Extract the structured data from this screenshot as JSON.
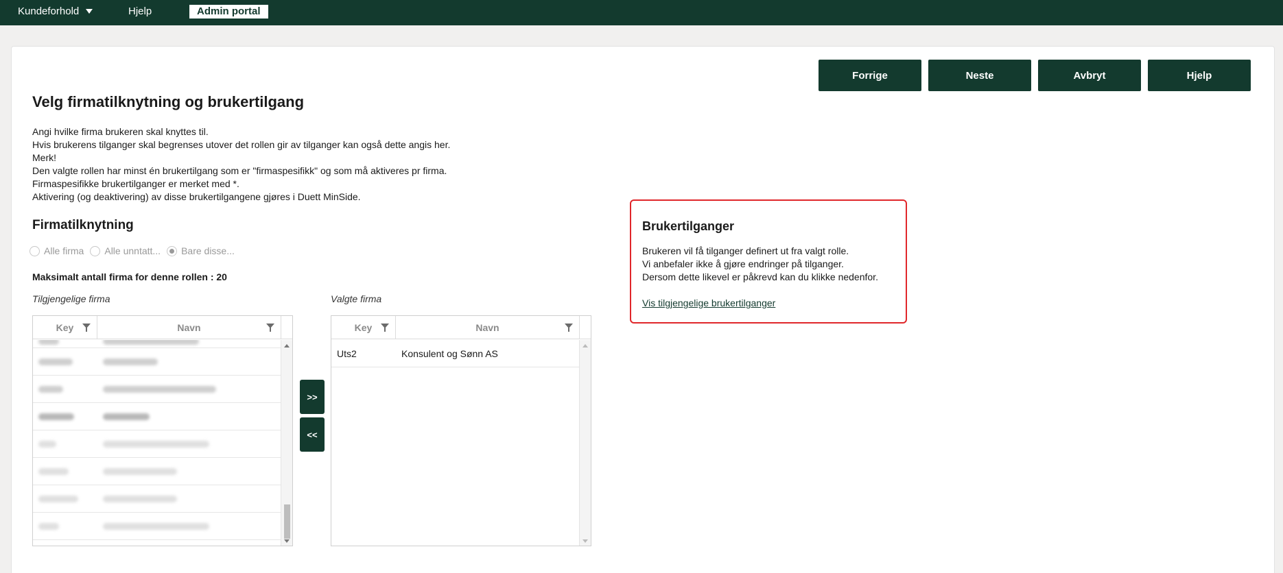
{
  "topnav": {
    "kundeforhold": "Kundeforhold",
    "hjelp": "Hjelp",
    "admin_portal": "Admin portal"
  },
  "actions": {
    "forrige": "Forrige",
    "neste": "Neste",
    "avbryt": "Avbryt",
    "hjelp": "Hjelp"
  },
  "page_title": "Velg firmatilknytning og brukertilgang",
  "intro_lines": [
    "Angi hvilke firma brukeren skal knyttes til.",
    "Hvis brukerens tilganger skal begrenses utover det rollen gir av tilganger kan også dette angis her.",
    "Merk!",
    "Den valgte rollen har minst én brukertilgang som er \"firmaspesifikk\" og som må aktiveres pr firma.",
    "Firmaspesifikke brukertilganger er merket med *.",
    "Aktivering (og deaktivering) av disse brukertilgangene gjøres i Duett MinSide."
  ],
  "firmatilknytning": {
    "title": "Firmatilknytning",
    "options": [
      "Alle firma",
      "Alle unntatt...",
      "Bare disse..."
    ],
    "selected_option": "Bare disse...",
    "max_label": "Maksimalt antall firma for denne rollen : 20"
  },
  "available": {
    "label": "Tilgjengelige firma",
    "col_key": "Key",
    "col_navn": "Navn"
  },
  "selected": {
    "label": "Valgte firma",
    "col_key": "Key",
    "col_navn": "Navn",
    "rows": [
      {
        "key": "Uts2",
        "navn": "Konsulent og Sønn AS"
      }
    ]
  },
  "move_buttons": {
    "add": ">>",
    "remove": "<<"
  },
  "brukertilganger": {
    "title": "Brukertilganger",
    "lines": [
      "Brukeren vil få tilganger definert ut fra valgt rolle.",
      "Vi anbefaler ikke å gjøre endringer på tilganger.",
      "Dersom dette likevel er påkrevd kan du klikke nedenfor."
    ],
    "link": "Vis tilgjengelige brukertilganger"
  },
  "colors": {
    "brand": "#133a2e",
    "highlight_border": "#e0262a"
  }
}
